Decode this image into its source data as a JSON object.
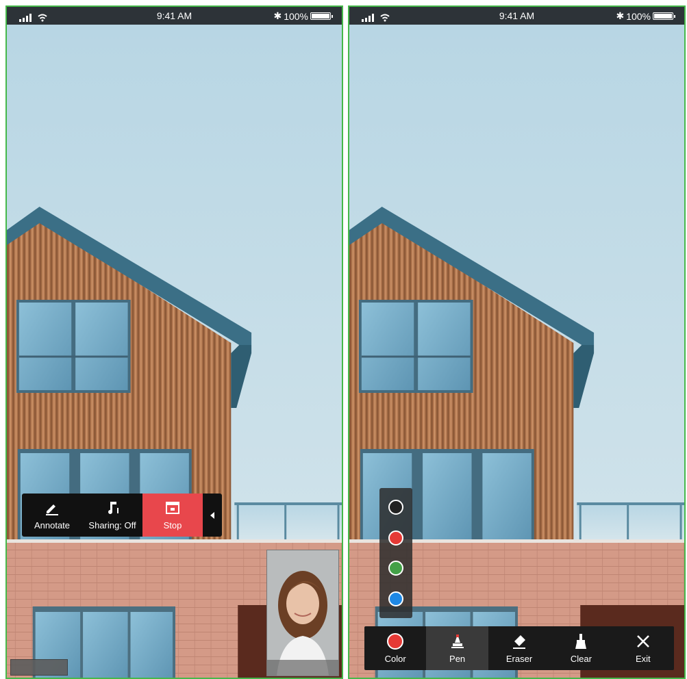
{
  "left_phone": {
    "status": {
      "time": "9:41 AM",
      "battery": "100%"
    },
    "toolbar": {
      "annotate_label": "Annotate",
      "sharing_label": "Sharing: Off",
      "stop_label": "Stop"
    }
  },
  "right_phone": {
    "status": {
      "time": "9:41 AM",
      "battery": "100%"
    },
    "color_options": [
      "#222222",
      "#e53935",
      "#43a047",
      "#1e88e5"
    ],
    "toolbar": {
      "color_label": "Color",
      "pen_label": "Pen",
      "eraser_label": "Eraser",
      "clear_label": "Clear",
      "exit_label": "Exit"
    },
    "selected_color": "#e53935",
    "active_tool": "Pen"
  },
  "colors": {
    "status_bar": "#2d3338",
    "stop_accent": "#e8474c",
    "frame_border": "#45b84a"
  }
}
